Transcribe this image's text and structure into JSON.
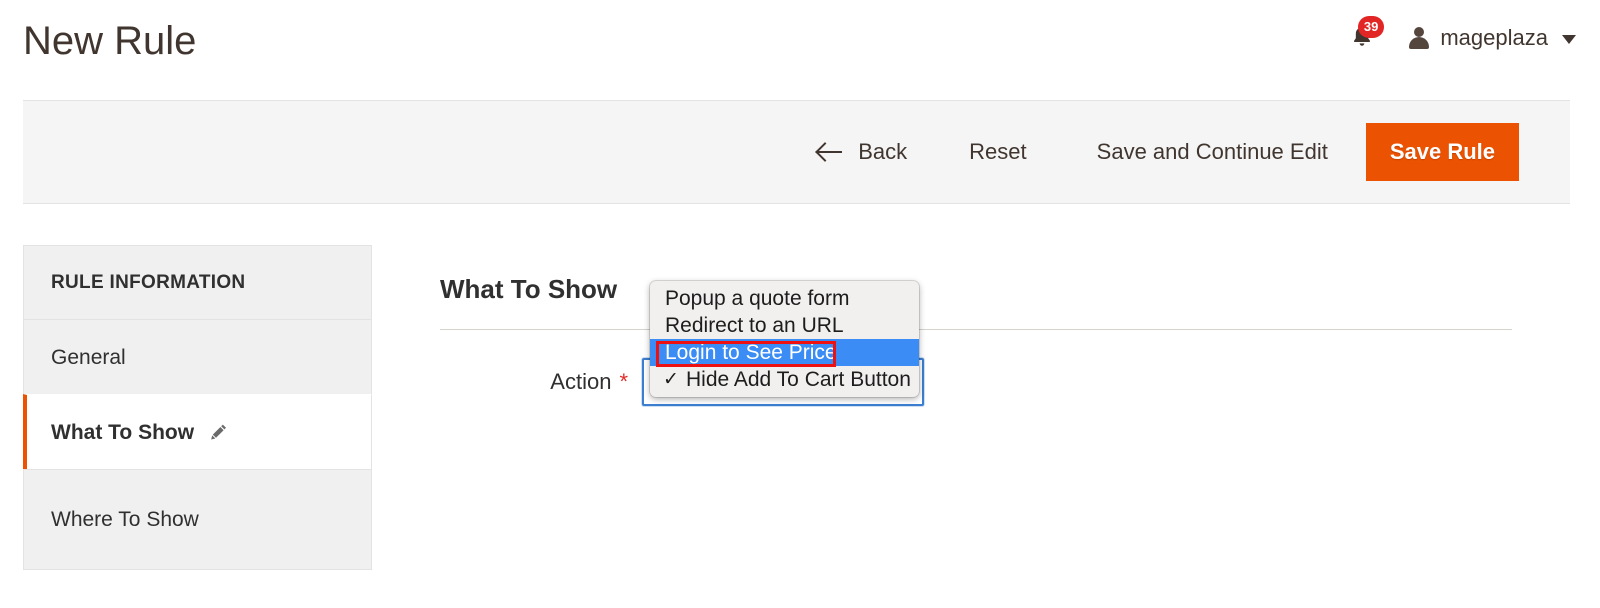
{
  "header": {
    "title": "New Rule",
    "notifications": {
      "icon": "bell-icon",
      "badge_count": "39"
    },
    "user": {
      "avatar_icon": "user-avatar-icon",
      "name": "mageplaza",
      "caret_icon": "chevron-down-icon"
    }
  },
  "page_actions": {
    "back_label": "Back",
    "back_icon": "arrow-left-icon",
    "reset_label": "Reset",
    "save_continue_label": "Save and Continue Edit",
    "save_rule_label": "Save Rule",
    "save_rule_color": "#eb5202"
  },
  "sidebar": {
    "title": "RULE INFORMATION",
    "items": [
      {
        "label": "General",
        "active": false
      },
      {
        "label": "What To Show",
        "active": true,
        "icon": "edit-pencil-icon"
      },
      {
        "label": "Where To Show",
        "active": false
      }
    ]
  },
  "main": {
    "section_heading": "What To Show",
    "field": {
      "label": "Action",
      "required_marker": "*",
      "selected_value": "Hide Add To Cart Button"
    }
  },
  "dropdown": {
    "open": true,
    "highlight_color": "#3b8cf4",
    "annotation_color": "#ee1111",
    "options": [
      {
        "label": "Popup a quote form",
        "checked": false,
        "highlighted": false
      },
      {
        "label": "Redirect to an URL",
        "checked": false,
        "highlighted": false
      },
      {
        "label": "Login to See Price",
        "checked": false,
        "highlighted": true
      },
      {
        "label": "Hide Add To Cart Button",
        "checked": true,
        "highlighted": false
      }
    ],
    "checkmark_glyph": "✓"
  }
}
